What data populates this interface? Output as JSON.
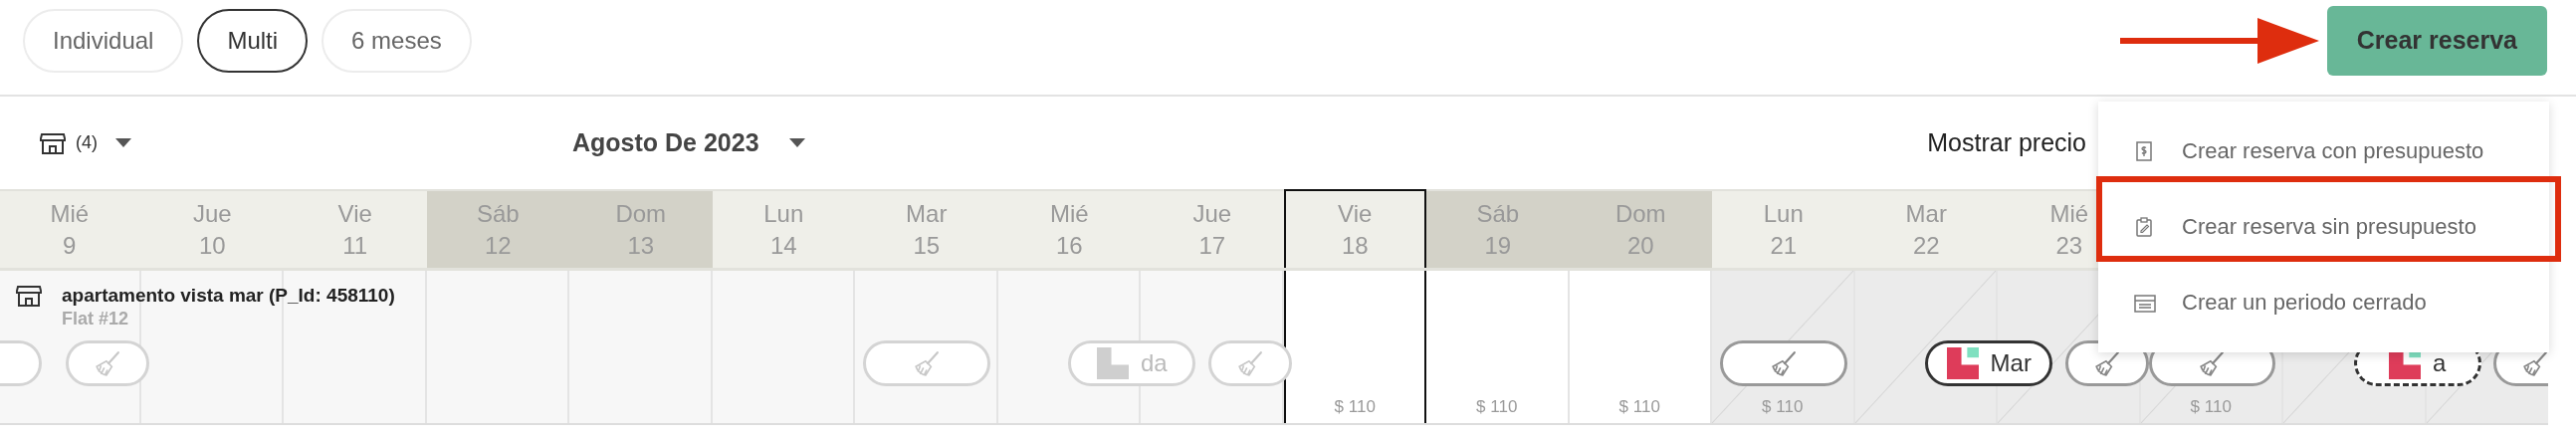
{
  "view_tabs": [
    {
      "label": "Individual",
      "selected": false
    },
    {
      "label": "Multi",
      "selected": true
    },
    {
      "label": "6 meses",
      "selected": false
    }
  ],
  "create_button": {
    "label": "Crear reserva"
  },
  "toolbar": {
    "property_filter": "(4)",
    "month": "Agosto De 2023",
    "price_toggle": "Mostrar precio"
  },
  "create_menu": [
    {
      "kind": "budget",
      "label": "Crear reserva con presupuesto",
      "annotated": false
    },
    {
      "kind": "clipboard",
      "label": "Crear reserva sin presupuesto",
      "annotated": true
    },
    {
      "kind": "calendar",
      "label": "Crear un periodo cerrado",
      "annotated": false
    }
  ],
  "days": [
    {
      "weekday": "Mié",
      "day": "9",
      "weekend": false,
      "today": false
    },
    {
      "weekday": "Jue",
      "day": "10",
      "weekend": false,
      "today": false
    },
    {
      "weekday": "Vie",
      "day": "11",
      "weekend": false,
      "today": false
    },
    {
      "weekday": "Sáb",
      "day": "12",
      "weekend": true,
      "today": false
    },
    {
      "weekday": "Dom",
      "day": "13",
      "weekend": true,
      "today": false
    },
    {
      "weekday": "Lun",
      "day": "14",
      "weekend": false,
      "today": false
    },
    {
      "weekday": "Mar",
      "day": "15",
      "weekend": false,
      "today": false
    },
    {
      "weekday": "Mié",
      "day": "16",
      "weekend": false,
      "today": false
    },
    {
      "weekday": "Jue",
      "day": "17",
      "weekend": false,
      "today": false
    },
    {
      "weekday": "Vie",
      "day": "18",
      "weekend": false,
      "today": true
    },
    {
      "weekday": "Sáb",
      "day": "19",
      "weekend": true,
      "today": false
    },
    {
      "weekday": "Dom",
      "day": "20",
      "weekend": true,
      "today": false
    },
    {
      "weekday": "Lun",
      "day": "21",
      "weekend": false,
      "today": false
    },
    {
      "weekday": "Mar",
      "day": "22",
      "weekend": false,
      "today": false
    },
    {
      "weekday": "Mié",
      "day": "23",
      "weekend": false,
      "today": false
    }
  ],
  "property": {
    "name": "apartamento vista mar (P_Id: 458110)",
    "unit": "Flat #12",
    "cells": [
      {
        "kind": "past",
        "items": [
          {
            "kind": "continued"
          },
          {
            "kind": "cleaning",
            "half": true
          }
        ]
      },
      {
        "kind": "past"
      },
      {
        "kind": "past"
      },
      {
        "kind": "past"
      },
      {
        "kind": "past"
      },
      {
        "kind": "past"
      },
      {
        "kind": "past",
        "items": [
          {
            "kind": "cleaning",
            "half": false
          }
        ]
      },
      {
        "kind": "past",
        "items": [
          {
            "kind": "booking",
            "label": "da",
            "pending": false
          }
        ]
      },
      {
        "kind": "past",
        "items": [
          {
            "kind": "cleaning",
            "half": true
          }
        ]
      },
      {
        "kind": "open",
        "price": "$ 110"
      },
      {
        "kind": "open",
        "price": "$ 110"
      },
      {
        "kind": "open",
        "price": "$ 110"
      },
      {
        "kind": "blocked",
        "price": "$ 110",
        "items": [
          {
            "kind": "cleaning",
            "half": false
          }
        ]
      },
      {
        "kind": "blocked",
        "items": [
          {
            "kind": "booking",
            "label": "Mar",
            "pending": false
          }
        ]
      },
      {
        "kind": "blocked",
        "items": [
          {
            "kind": "cleaning",
            "half": true
          }
        ]
      },
      {
        "kind": "blocked",
        "price": "$ 110",
        "items": [
          {
            "kind": "cleaning",
            "half": false
          }
        ]
      },
      {
        "kind": "blocked",
        "items": [
          {
            "kind": "booking",
            "label": "a",
            "pending": true
          }
        ]
      },
      {
        "kind": "blocked",
        "items": [
          {
            "kind": "cleaning",
            "half": true
          }
        ]
      }
    ]
  }
}
